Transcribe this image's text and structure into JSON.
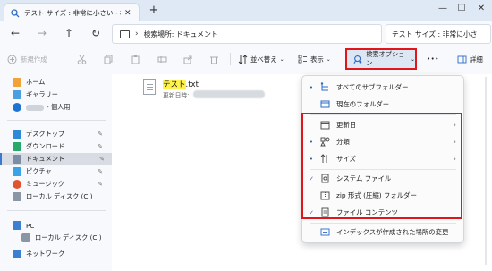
{
  "window": {
    "tab_title": "テスト サイズ : 非常に小さい - 検S",
    "min_glyph": "—",
    "max_glyph": "☐",
    "close_glyph": "✕",
    "newtab_glyph": "+",
    "tab_close_glyph": "✕"
  },
  "address": {
    "location": "検索場所: ドキュメント",
    "chevron": "›",
    "search_text": "テスト サイズ : 非常に小さ"
  },
  "nav_glyphs": {
    "back": "←",
    "forward": "→",
    "up": "↑",
    "refresh": "↻"
  },
  "toolbar": {
    "new_label": "新規作成",
    "sort_label": "並べ替え",
    "view_label": "表示",
    "search_options_label": "検索オプション",
    "more_glyph": "•••",
    "details_label": "詳細"
  },
  "sidebar": {
    "items": [
      {
        "label": "ホーム"
      },
      {
        "label": "ギャラリー"
      },
      {
        "label": "- 個人用"
      },
      {
        "label": "デスクトップ"
      },
      {
        "label": "ダウンロード"
      },
      {
        "label": "ドキュメント"
      },
      {
        "label": "ピクチャ"
      },
      {
        "label": "ミュージック"
      },
      {
        "label": "ローカル ディスク (C:)"
      },
      {
        "label": "PC"
      },
      {
        "label": "ローカル ディスク (C:)"
      },
      {
        "label": "ネットワーク"
      }
    ],
    "pin_glyph": "📌"
  },
  "file": {
    "name_highlight": "テスト",
    "name_rest": ".txt",
    "date_label": "更新日時:"
  },
  "menu": {
    "items": [
      {
        "label": "すべてのサブフォルダー",
        "mark": "•"
      },
      {
        "label": "現在のフォルダー",
        "mark": ""
      },
      {
        "label": "更新日",
        "mark": ""
      },
      {
        "label": "分類",
        "mark": "•"
      },
      {
        "label": "サイズ",
        "mark": "•"
      },
      {
        "label": "システム ファイル",
        "mark": "✓"
      },
      {
        "label": "zip 形式 (圧縮) フォルダー",
        "mark": ""
      },
      {
        "label": "ファイル コンテンツ",
        "mark": "✓"
      },
      {
        "label": "インデックスが作成された場所の変更",
        "mark": ""
      }
    ],
    "arrow_glyph": "›"
  },
  "colors": {
    "accent": "#3a78d4",
    "highlight_box": "#e0161b",
    "search_highlight": "#fff24a"
  }
}
